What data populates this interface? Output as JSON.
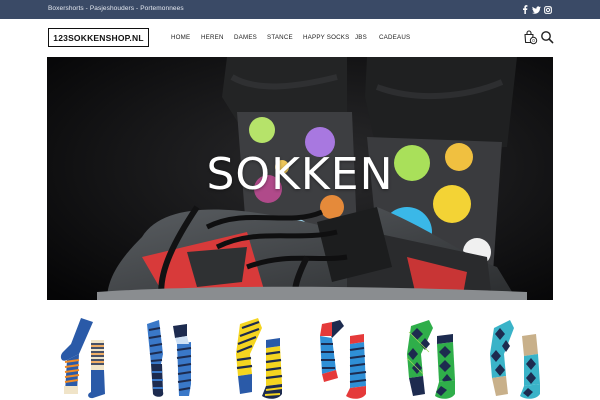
{
  "topbar": {
    "links_text": "Boxershorts - Pasjeshouders - Portemonnees",
    "social_icons": [
      "facebook-icon",
      "twitter-icon",
      "instagram-icon"
    ]
  },
  "header": {
    "logo_text": "123SOKKENSHOP.NL",
    "nav": [
      {
        "label": "HOME"
      },
      {
        "label": "HEREN"
      },
      {
        "label": "DAMES"
      },
      {
        "label": "STANCE"
      },
      {
        "label": "HAPPY SOCKS"
      },
      {
        "label": "JBS"
      },
      {
        "label": "CADEAUS"
      }
    ],
    "icons": [
      "shopping-bag-icon",
      "search-icon"
    ],
    "cart_count": "0"
  },
  "hero": {
    "title": "SOKKEN"
  },
  "products": [
    {
      "name": "socks-blue-orange-stripes",
      "colors": [
        "#2a5aa8",
        "#f08a24",
        "#1d2b4f"
      ]
    },
    {
      "name": "socks-blue-navy-stripes",
      "colors": [
        "#3a78c8",
        "#1d2b4f",
        "#cfe1f5"
      ]
    },
    {
      "name": "socks-yellow-navy-stripes",
      "colors": [
        "#f5d520",
        "#1d2b4f",
        "#3a78c8"
      ]
    },
    {
      "name": "socks-red-blue-stripes",
      "colors": [
        "#e53a3a",
        "#2f8fd6",
        "#1d2b4f"
      ]
    },
    {
      "name": "socks-green-argyle",
      "colors": [
        "#2fae4a",
        "#1d2b4f",
        "#9ad45a"
      ]
    },
    {
      "name": "socks-teal-argyle",
      "colors": [
        "#3ab3c8",
        "#1d2b4f",
        "#c8b08a"
      ]
    }
  ],
  "colors": {
    "topbar_bg": "#3a4a66",
    "hero_bg": "#0b0b0c"
  }
}
